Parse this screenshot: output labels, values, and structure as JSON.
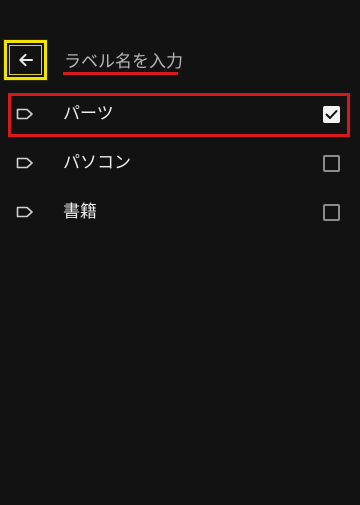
{
  "header": {
    "back_icon": "arrow-left-icon",
    "search_placeholder": "ラベル名を入力",
    "search_value": ""
  },
  "colors": {
    "background": "#121212",
    "highlight_red": "#d7191c",
    "highlight_yellow": "#f2e400"
  },
  "labels": [
    {
      "name": "パーツ",
      "icon": "label-icon",
      "checked": true
    },
    {
      "name": "パソコン",
      "icon": "label-icon",
      "checked": false
    },
    {
      "name": "書籍",
      "icon": "label-icon",
      "checked": false
    }
  ]
}
